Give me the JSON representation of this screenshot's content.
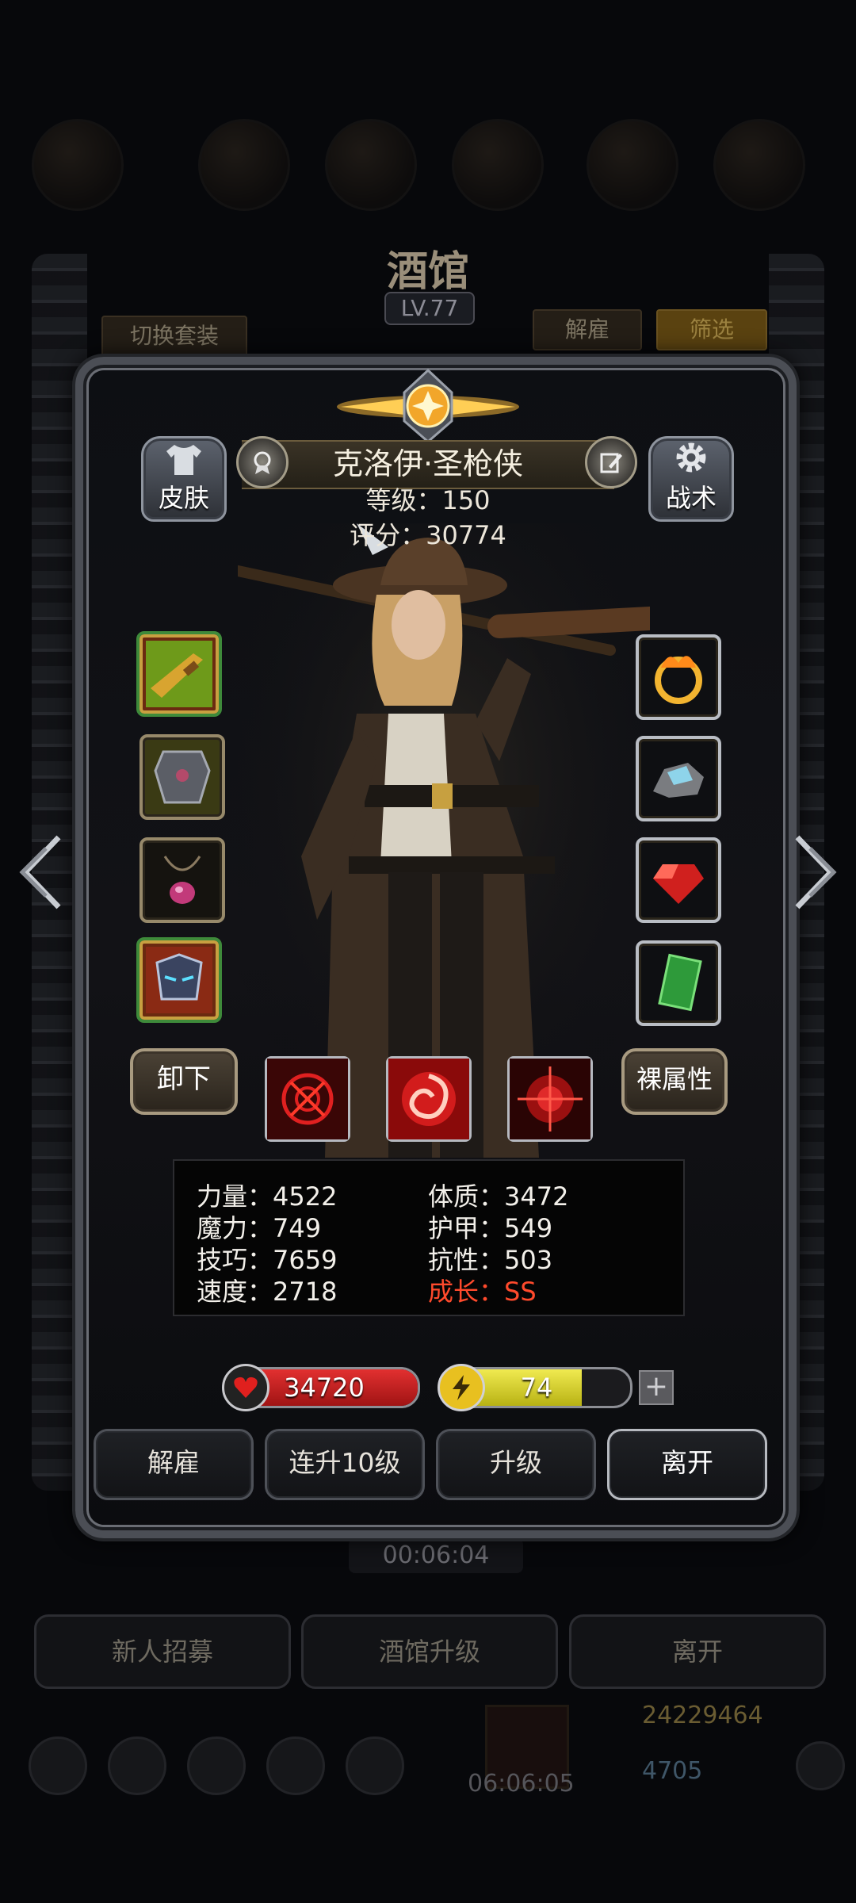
{
  "background": {
    "title": "酒馆",
    "level": "LV.77",
    "switch_outfit": "切换套装",
    "dismiss_top": "解雇",
    "filter": "筛选",
    "timer": "00:06:04",
    "bottom_buttons": [
      "新人招募",
      "酒馆升级",
      "离开"
    ],
    "timer2": "06:06:05",
    "gold": "24229464",
    "gems": "4705"
  },
  "hero": {
    "name": "克洛伊·圣枪侠",
    "level_label": "等级：150",
    "score_label": "评分：30774",
    "skin_label": "皮肤",
    "tactics_label": "战术"
  },
  "equipment": {
    "left": [
      "golden-shotgun",
      "chest-armor",
      "gem-necklace",
      "demon-helmet"
    ],
    "right": [
      "flame-ring",
      "crystal-ore",
      "red-ruby",
      "green-card"
    ]
  },
  "actions": {
    "unequip": "卸下",
    "base_attributes": "裸属性",
    "skills": [
      "crosshair-skill",
      "spiral-skill",
      "target-skill"
    ]
  },
  "stats": {
    "strength": "力量：4522",
    "physique": "体质：3472",
    "magic": "魔力：749",
    "armor": "护甲：549",
    "skill": "技巧：7659",
    "resistance": "抗性：503",
    "speed": "速度：2718",
    "growth": "成长：SS"
  },
  "vitals": {
    "hp": "34720",
    "hp_fill": 1.0,
    "energy": "74",
    "energy_fill": 0.74
  },
  "buttons": {
    "dismiss": "解雇",
    "level_up_10": "连升10级",
    "level_up": "升级",
    "leave": "离开"
  },
  "colors": {
    "hp": "#c81d1d",
    "energy": "#d8d22a",
    "growth": "#ff4a2c"
  }
}
